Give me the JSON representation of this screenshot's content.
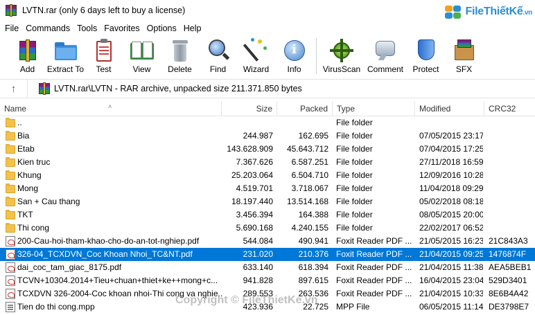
{
  "window": {
    "title": "LVTN.rar (only 6 days left to buy a license)"
  },
  "brand": {
    "text": "FileThiếtKế",
    "suffix": ".vn"
  },
  "menu": [
    "File",
    "Commands",
    "Tools",
    "Favorites",
    "Options",
    "Help"
  ],
  "toolbar": [
    {
      "label": "Add",
      "icon": "add-archive-icon"
    },
    {
      "label": "Extract To",
      "icon": "extract-folder-icon"
    },
    {
      "label": "Test",
      "icon": "test-clipboard-icon"
    },
    {
      "label": "View",
      "icon": "view-book-icon"
    },
    {
      "label": "Delete",
      "icon": "trash-can-icon"
    },
    {
      "label": "Find",
      "icon": "magnifier-icon"
    },
    {
      "label": "Wizard",
      "icon": "magic-wand-icon"
    },
    {
      "label": "Info",
      "icon": "info-icon"
    },
    {
      "label": "VirusScan",
      "icon": "virus-scan-icon"
    },
    {
      "label": "Comment",
      "icon": "comment-icon"
    },
    {
      "label": "Protect",
      "icon": "shield-icon"
    },
    {
      "label": "SFX",
      "icon": "sfx-box-icon"
    }
  ],
  "address": {
    "path": "LVTN.rar\\LVTN - RAR archive, unpacked size 211.371.850 bytes"
  },
  "columns": {
    "name": "Name",
    "size": "Size",
    "packed": "Packed",
    "type": "Type",
    "modified": "Modified",
    "crc": "CRC32"
  },
  "files": [
    {
      "name": "..",
      "size": "",
      "packed": "",
      "type": "File folder",
      "modified": "",
      "crc": "",
      "kind": "folder"
    },
    {
      "name": "Bia",
      "size": "244.987",
      "packed": "162.695",
      "type": "File folder",
      "modified": "07/05/2015 23:17",
      "crc": "",
      "kind": "folder"
    },
    {
      "name": "Etab",
      "size": "143.628.909",
      "packed": "45.643.712",
      "type": "File folder",
      "modified": "07/04/2015 17:25",
      "crc": "",
      "kind": "folder"
    },
    {
      "name": "Kien truc",
      "size": "7.367.626",
      "packed": "6.587.251",
      "type": "File folder",
      "modified": "27/11/2018 16:59",
      "crc": "",
      "kind": "folder"
    },
    {
      "name": "Khung",
      "size": "25.203.064",
      "packed": "6.504.710",
      "type": "File folder",
      "modified": "12/09/2016 10:28",
      "crc": "",
      "kind": "folder"
    },
    {
      "name": "Mong",
      "size": "4.519.701",
      "packed": "3.718.067",
      "type": "File folder",
      "modified": "11/04/2018 09:29",
      "crc": "",
      "kind": "folder"
    },
    {
      "name": "San + Cau thang",
      "size": "18.197.440",
      "packed": "13.514.168",
      "type": "File folder",
      "modified": "05/02/2018 08:18",
      "crc": "",
      "kind": "folder"
    },
    {
      "name": "TKT",
      "size": "3.456.394",
      "packed": "164.388",
      "type": "File folder",
      "modified": "08/05/2015 20:00",
      "crc": "",
      "kind": "folder"
    },
    {
      "name": "Thi cong",
      "size": "5.690.168",
      "packed": "4.240.155",
      "type": "File folder",
      "modified": "22/02/2017 06:52",
      "crc": "",
      "kind": "folder"
    },
    {
      "name": "200-Cau-hoi-tham-khao-cho-do-an-tot-nghiep.pdf",
      "size": "544.084",
      "packed": "490.941",
      "type": "Foxit Reader PDF ...",
      "modified": "21/05/2015 16:23",
      "crc": "21C843A3",
      "kind": "pdf"
    },
    {
      "name": "326-04_TCXDVN_Coc Khoan Nhoi_TC&NT.pdf",
      "size": "231.020",
      "packed": "210.376",
      "type": "Foxit Reader PDF ...",
      "modified": "21/04/2015 09:25",
      "crc": "1476874F",
      "kind": "pdf",
      "selected": true
    },
    {
      "name": "dai_coc_tam_giac_8175.pdf",
      "size": "633.140",
      "packed": "618.394",
      "type": "Foxit Reader PDF ...",
      "modified": "21/04/2015 11:38",
      "crc": "AEA5BEB1",
      "kind": "pdf"
    },
    {
      "name": "TCVN+10304.2014+Tieu+chuan+thiet+ke++mong+c...",
      "size": "941.828",
      "packed": "897.615",
      "type": "Foxit Reader PDF ...",
      "modified": "16/04/2015 23:04",
      "crc": "529D3401",
      "kind": "pdf"
    },
    {
      "name": "TCXDVN 326-2004-Coc khoan nhoi-Thi cong va nghie...",
      "size": "289.553",
      "packed": "263.536",
      "type": "Foxit Reader PDF ...",
      "modified": "21/04/2015 10:33",
      "crc": "8E6B4A42",
      "kind": "pdf"
    },
    {
      "name": "Tien do thi cong.mpp",
      "size": "423.936",
      "packed": "22.725",
      "type": "MPP File",
      "modified": "06/05/2015 11:14",
      "crc": "DE3798E7",
      "kind": "mpp"
    }
  ],
  "watermark": "Copyright © FileThietKe.vn"
}
